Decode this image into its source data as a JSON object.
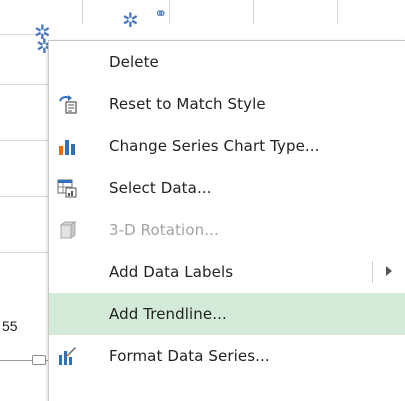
{
  "background": {
    "cell_value": "55"
  },
  "context_menu": {
    "items": [
      {
        "label": "Delete",
        "icon": "none",
        "enabled": true
      },
      {
        "label": "Reset to Match Style",
        "icon": "reset-style-icon",
        "enabled": true
      },
      {
        "label": "Change Series Chart Type...",
        "icon": "chart-type-icon",
        "enabled": true
      },
      {
        "label": "Select Data...",
        "icon": "select-data-icon",
        "enabled": true
      },
      {
        "label": "3-D Rotation...",
        "icon": "3d-rotation-icon",
        "enabled": false
      },
      {
        "label": "Add Data Labels",
        "icon": "none",
        "enabled": true,
        "has_submenu": true
      },
      {
        "label": "Add Trendline...",
        "icon": "none",
        "enabled": true,
        "highlighted": true
      },
      {
        "label": "Format Data Series...",
        "icon": "format-series-icon",
        "enabled": true
      }
    ]
  },
  "colors": {
    "highlight": "#d3ead8",
    "chart_orange": "#e46c0a",
    "chart_blue": "#2e6fbe",
    "marker": "#4a78c2"
  }
}
